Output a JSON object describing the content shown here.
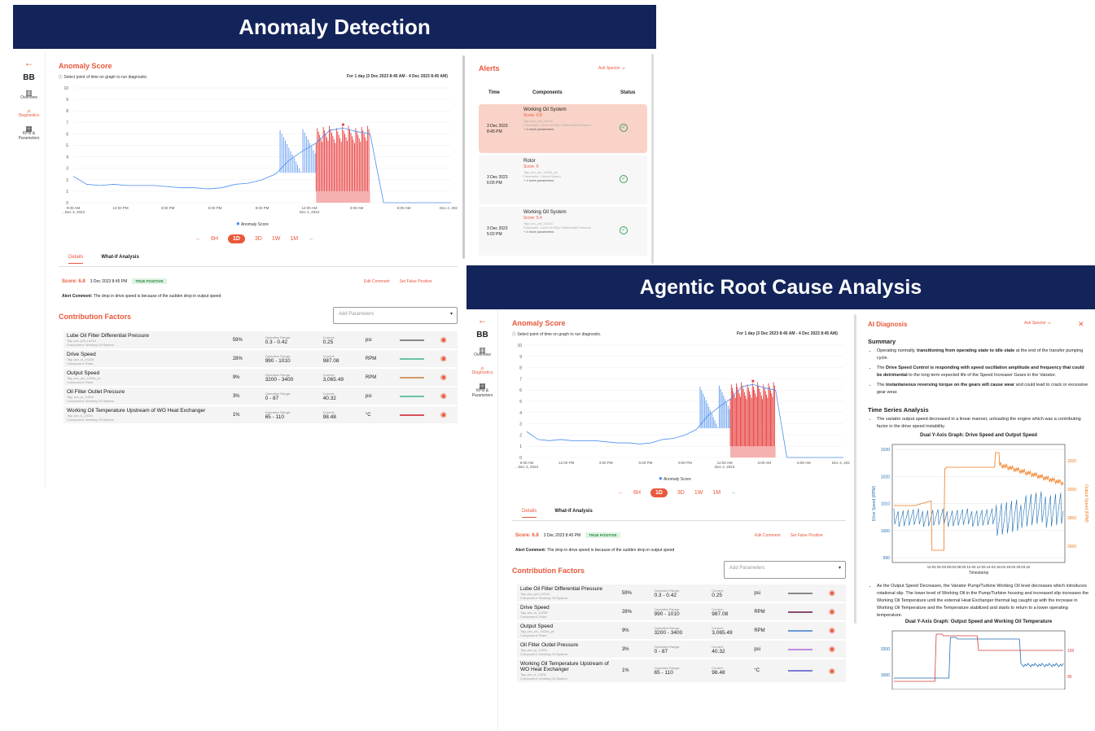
{
  "banner1": "Anomaly Detection",
  "banner2_a": "Agentic",
  "banner2_b": "Root Cause Analysis",
  "sidebar": {
    "brand": "BB",
    "back": "←",
    "items": [
      {
        "label": "Overview",
        "icon": "▥"
      },
      {
        "label": "Diagnostics",
        "icon": "⌕"
      },
      {
        "label": "KPIs & Parameters",
        "icon": "▦"
      }
    ]
  },
  "anomaly": {
    "title": "Anomaly Score",
    "hint": "Select point of time on graph to run diagnostic.",
    "range_text": "For 1 day (3 Dec 2023 8:45 AM - 4 Dec 2023 8:45 AM)",
    "legend": "Anomaly Score"
  },
  "chart_data": {
    "type": "line",
    "title": "Anomaly Score",
    "xlabel": "",
    "ylabel": "",
    "x_ticks": [
      "9:00 AM\n...Dec 3, 2023",
      "12:00 PM",
      "3:00 PM",
      "6:00 PM",
      "9:00 PM",
      "12:00 AM\nDec 4, 2023",
      "3:00 AM",
      "6:00 AM",
      "Dec 4, 2023..."
    ],
    "ylim": [
      0,
      10
    ],
    "y_ticks": [
      0,
      1,
      2,
      3,
      4,
      5,
      6,
      7,
      8,
      9,
      10
    ],
    "series": [
      {
        "name": "Anomaly Score",
        "color": "#4a8ef0",
        "x": [
          0,
          0.5,
          1,
          1.5,
          2,
          2.5,
          3,
          3.5,
          4,
          4.5,
          5,
          5.5,
          6,
          6.5,
          7,
          7.5,
          8,
          8.5,
          9,
          9.5,
          10,
          10.5,
          11,
          11.5,
          12,
          12.5,
          13,
          13.5,
          14
        ],
        "values": [
          2.3,
          1.6,
          1.5,
          1.6,
          1.5,
          1.5,
          1.5,
          1.4,
          1.3,
          1.3,
          1.2,
          1.3,
          1.6,
          1.7,
          2.0,
          2.5,
          3.7,
          4.5,
          5.2,
          6.3,
          6.5,
          6.2,
          6.0,
          0,
          0,
          0,
          0,
          0,
          0
        ]
      }
    ],
    "highlight": {
      "from_x": 9.0,
      "to_x": 11.0,
      "color": "#e84040",
      "max": 6.8
    }
  },
  "ranges": [
    "←",
    "6H",
    "1D",
    "3D",
    "1W",
    "1M",
    "→"
  ],
  "tabs": {
    "details": "Details",
    "whatif": "What-if Analysis"
  },
  "score": {
    "label": "Score: 6.8",
    "time": "3 Dec 2023 8:45 PM",
    "badge": "TRUE POSITIVE",
    "edit": "Edit Comment",
    "false": "Set False Positive"
  },
  "comment": {
    "label": "Alert Comment:",
    "text": "The drop in drive speed is because of the sudden drop in output speed"
  },
  "cf": {
    "title": "Contribution Factors",
    "add": "Add Parameters",
    "op_label": "Operation Range:",
    "cur_label": "Current:",
    "rows": [
      {
        "name": "Lube Oil Filter Differential Pressure",
        "tag": "Tag: pcc_pdi_14216",
        "comp": "Component: Working Oil System",
        "pct": "59%",
        "range": "0.3 - 0.42",
        "cur": "0.25",
        "unit": "psi",
        "color": "#888888"
      },
      {
        "name": "Drive Speed",
        "tag": "Tag: pcc_si_14226",
        "comp": "Component: Rotor",
        "pct": "28%",
        "range": "990 - 1010",
        "cur": "987.08",
        "unit": "RPM",
        "color": "#6ac2a2"
      },
      {
        "name": "Output Speed",
        "tag": "Tag: pcc_sic_1422a_pv",
        "comp": "Component: Rotor",
        "pct": "9%",
        "range": "3200 - 3400",
        "cur": "3,065.49",
        "unit": "RPM",
        "color": "#d49a6a"
      },
      {
        "name": "Oil Filter Outlet Pressure",
        "tag": "Tag: pcc_pi_1422c",
        "comp": "Component: Working Oil System",
        "pct": "3%",
        "range": "0 - 87",
        "cur": "40.32",
        "unit": "psi",
        "color": "#6ac2a2"
      },
      {
        "name": "Working Oil Temperature Upstream of WO Heat Exchanger",
        "tag": "Tag: pcc_ti_1423c",
        "comp": "Component: Working Oil System",
        "pct": "1%",
        "range": "65 - 110",
        "cur": "98.48",
        "unit": "°C",
        "color": "#d9505a"
      }
    ]
  },
  "cf2colors": [
    "#888888",
    "#8a4a6a",
    "#6a9ad4",
    "#c28ae0",
    "#7a7ad4"
  ],
  "alerts": {
    "title": "Alerts",
    "ask": "Ask Spector",
    "cols": [
      "Time",
      "Components",
      "Status"
    ],
    "rows": [
      {
        "date": "3 Dec 2023",
        "time": "8:45 PM",
        "comp": "Working Oil System",
        "score": "Score: 6.8",
        "tag": "Tag: pcc_pdi_14216",
        "param": "Parameter: Lube Oil Filter Differential Pressure",
        "more": "+ 4 more parameters"
      },
      {
        "date": "3 Dec 2023",
        "time": "6:05 PM",
        "comp": "Rotor",
        "score": "Score: 6",
        "tag": "Tag: pcc_sic_1422a_pv",
        "param": "Parameter: Output Speed",
        "more": "+ 4 more parameters"
      },
      {
        "date": "3 Dec 2023",
        "time": "5:02 PM",
        "comp": "Working Oil System",
        "score": "Score: 5.4",
        "tag": "Tag: pcc_pdi_14216",
        "param": "Parameter: Lube Oil Filter Differential Pressure",
        "more": "+ 4 more parameters"
      }
    ]
  },
  "diag": {
    "title": "AI Diagnosis",
    "ask": "Ask Spector",
    "close": "✕",
    "summary": "Summary",
    "s1a": "Operating normally, ",
    "s1b": "transitioning from operating state to idle state",
    "s1c": " at the end of the transfer pumping cycle.",
    "s2a": "The ",
    "s2b": "Drive Speed Control is responding with speed oscillation amplitude and frequency that could be detrimental",
    "s2c": " to the long term expected life of the Speed Increaser Gears in the Variator.",
    "s3a": "The ",
    "s3b": "instantaneous reversing torque on the gears will cause wear",
    "s3c": " and could lead to crack or excessive gear wear.",
    "tsa": "Time Series Analysis",
    "t1": "The variator output speed decreased in a linear manner, unloading the engine which was a contributing factor in the drive speed instability.",
    "g1": "Dual Y-Axis Graph: Drive Speed and Output Speed",
    "g1_yl": "Drive Speed (RPM)",
    "g1_yr": "Output Speed (RPM)",
    "g1_x": "Timestamp",
    "g1_yticks": [
      "1030",
      "1020",
      "1010",
      "1000",
      "990"
    ],
    "g1_ryticks": [
      "3200",
      "3000",
      "2800",
      "2600"
    ],
    "g1_xticks": "12-03 04-03 08-03 08-03 12-03 12-03 14-03 16-03 18-03 20-03 22",
    "t2": "As the Output Speed Decreases, the Variator Pump/Turbine Working Oil level decreases which introduces rotational slip. The lower level of Working Oil in the Pump/Turbine housing and increased slip increases the Working Oil Temperature until the external Heat Exchanger thermal lag caught up with the increase in Working Oil Temperature and the Temperature stabilized and starts to return to a lower operating temperature.",
    "g2": "Dual Y-Axis Graph: Output Speed and Working Oil Temperature",
    "g2_yticks": [
      "3200",
      "3000"
    ],
    "g2_ryticks": [
      "100",
      "95"
    ]
  }
}
